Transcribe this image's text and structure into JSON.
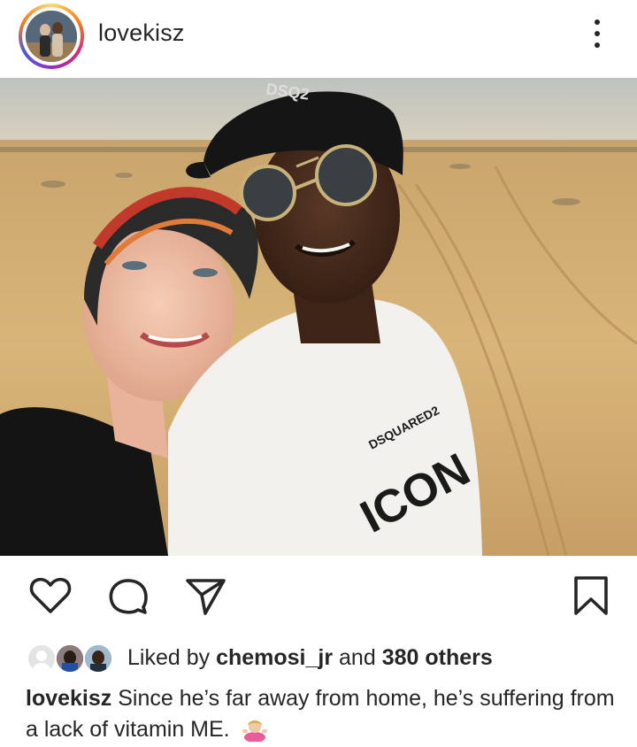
{
  "post": {
    "username": "lovekisz",
    "more_icon": "more-vertical-icon",
    "photo_shirt_text_top": "DSQUARED2",
    "photo_shirt_text_main": "ICON",
    "photo_cap_text": "DSQ2"
  },
  "actions": {
    "like_icon": "heart-icon",
    "comment_icon": "comment-icon",
    "share_icon": "send-icon",
    "save_icon": "bookmark-icon"
  },
  "likes": {
    "prefix": "Liked by ",
    "user": "chemosi_jr",
    "middle": " and ",
    "others": "380 others"
  },
  "caption": {
    "username": "lovekisz",
    "text": "Since he’s far away from home, he’s suffering from a lack of vitamin ME.",
    "emoji": "person-shrugging-emoji"
  },
  "colors": {
    "text": "#262626",
    "ring_start": "#feda75",
    "ring_mid": "#d62976",
    "ring_end": "#4f5bd5"
  }
}
